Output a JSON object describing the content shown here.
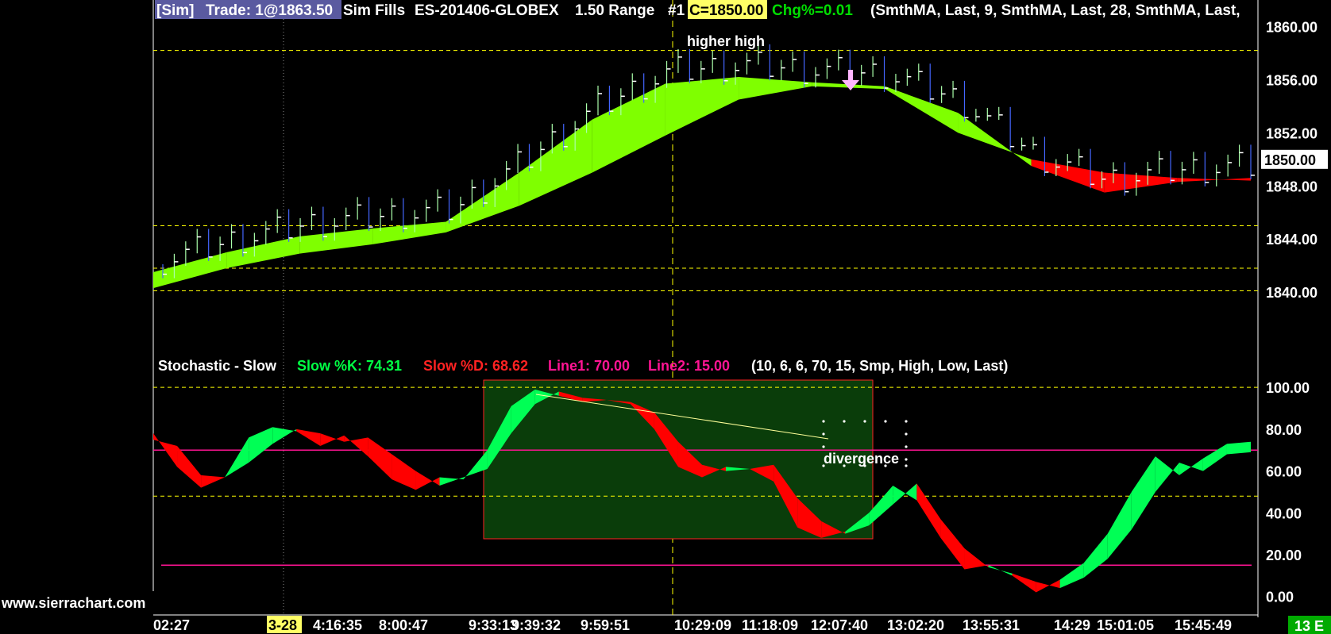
{
  "colors": {
    "background": "#000000",
    "guide": "#ffff00",
    "ribbon_up": "#7fff00",
    "ribbon_down": "#ff0000",
    "stoch_up": "#00ff55",
    "stoch_down": "#ff0000",
    "limit_line": "#ff1493",
    "bar_up": "#aaffaa",
    "bar_down": "#4466ff",
    "highlight": "#0a3d0a"
  },
  "header": {
    "sim_tag": "[Sim]",
    "trade": "Trade: 1@1863.50",
    "fills": "Sim Fills",
    "symbol": "ES-201406-GLOBEX",
    "range": "1.50 Range",
    "chart_no": "#1",
    "close": "C=1850.00",
    "change": "Chg%=0.01",
    "studies": "(SmthMA, Last, 9, SmthMA, Last, 28, SmthMA, Last,"
  },
  "stoch_header": {
    "name": "Stochastic - Slow",
    "k": "Slow %K: 74.31",
    "d": "Slow %D: 68.62",
    "line1": "Line1: 70.00",
    "line2": "Line2: 15.00",
    "params": "(10, 6, 6, 70, 15, Smp, High, Low, Last)"
  },
  "annotations": {
    "higher_high": "higher high",
    "divergence": "divergence",
    "arrow": "down-arrow-icon"
  },
  "footer": {
    "watermark": "www.sierrachart.com",
    "date_marker": "3-28",
    "bar_count": "13 E"
  },
  "chart_data": [
    {
      "type": "line",
      "title": "ES-201406-GLOBEX 1.50 Range",
      "ylim": [
        1837.5,
        1862
      ],
      "ytick_labels": [
        "1860.00",
        "1856.00",
        "1852.00",
        "1848.00",
        "1844.00",
        "1840.00"
      ],
      "ytick_values": [
        1860,
        1856,
        1852,
        1848,
        1844,
        1840
      ],
      "last_price_label": "1850.00",
      "last_price": 1850,
      "guide_levels": [
        1858.2,
        1845.0,
        1841.8,
        1840.1
      ],
      "x": [
        "02:27",
        "3-28",
        "4:16:35",
        "8:00:47",
        "9:33:13",
        "9:39:32",
        "9:59:51",
        "10:29:09",
        "11:18:09",
        "12:07:40",
        "13:02:20",
        "13:55:31",
        "14:29",
        "15:01:05",
        "15:45:49"
      ],
      "series": [
        {
          "name": "SmthMA 9",
          "values": [
            1841.5,
            1843.0,
            1844.2,
            1844.8,
            1845.3,
            1849.0,
            1853.0,
            1855.7,
            1856.2,
            1855.8,
            1855.5,
            1853.5,
            1849.5,
            1847.5,
            1848.3,
            1848.6
          ]
        },
        {
          "name": "SmthMA 28",
          "values": [
            1840.3,
            1841.8,
            1842.9,
            1843.6,
            1844.5,
            1846.5,
            1849.0,
            1851.8,
            1854.5,
            1855.5,
            1855.3,
            1852.0,
            1850.0,
            1849.0,
            1848.6,
            1848.4
          ]
        }
      ]
    },
    {
      "type": "area",
      "title": "Stochastic - Slow",
      "ylim": [
        -2,
        105
      ],
      "ytick_labels": [
        "100.00",
        "80.00",
        "60.00",
        "40.00",
        "20.00",
        "0.00"
      ],
      "ytick_values": [
        100,
        80,
        60,
        40,
        20,
        0
      ],
      "line1": 70,
      "line2": 15,
      "guide_levels": [
        100,
        48
      ],
      "series": [
        {
          "name": "Slow %K",
          "values": [
            78,
            62,
            52,
            57,
            76,
            81,
            79,
            72,
            77,
            67,
            56,
            51,
            57,
            56,
            70,
            91,
            99,
            96,
            93,
            94,
            92,
            80,
            62,
            57,
            62,
            61,
            55,
            33,
            28,
            31,
            40,
            53,
            46,
            28,
            13,
            15,
            10,
            2,
            8,
            16,
            30,
            50,
            67,
            58,
            66,
            73,
            74
          ]
        },
        {
          "name": "Slow %D",
          "values": [
            75,
            72,
            58,
            57,
            64,
            73,
            80,
            78,
            74,
            76,
            68,
            60,
            53,
            57,
            61,
            78,
            92,
            98,
            95,
            94,
            93,
            88,
            74,
            63,
            60,
            61,
            63,
            47,
            36,
            30,
            34,
            44,
            54,
            37,
            23,
            14,
            11,
            7,
            4,
            9,
            18,
            32,
            50,
            64,
            60,
            68,
            69
          ]
        }
      ]
    }
  ]
}
